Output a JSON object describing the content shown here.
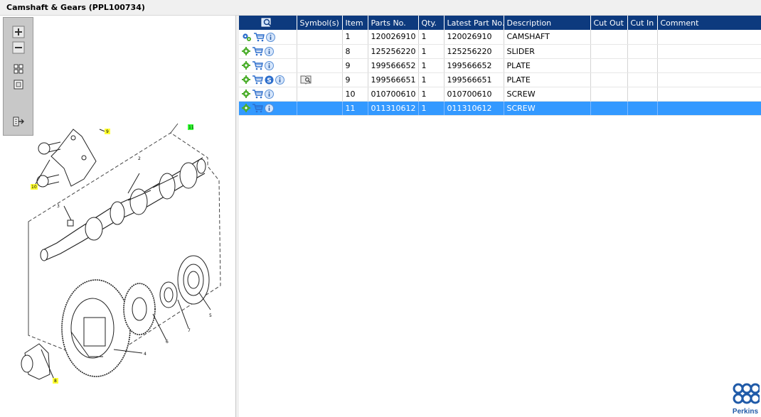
{
  "window": {
    "title": "Camshaft & Gears (PPL100734)"
  },
  "toolbox": {
    "tools": [
      "zoom-in-icon",
      "zoom-out-icon",
      "fit-all-icon",
      "fit-window-icon",
      "export-icon"
    ]
  },
  "diagram": {
    "callouts": {
      "c9": "9",
      "c10": "10",
      "c11": "11",
      "c8": "8",
      "c2": "2",
      "c3": "3",
      "c4": "4",
      "c5": "5",
      "c6": "6",
      "c7": "7"
    }
  },
  "table": {
    "headers": [
      "",
      "Symbol(s)",
      "Item",
      "Parts No.",
      "Qty.",
      "Latest Part No.",
      "Description",
      "Cut Out",
      "Cut In",
      "Comment"
    ],
    "rows": [
      {
        "item": "1",
        "parts_no": "120026910",
        "qty": "1",
        "latest": "120026910",
        "description": "CAMSHAFT",
        "cut_out": "",
        "cut_in": "",
        "comment": ""
      },
      {
        "item": "8",
        "parts_no": "125256220",
        "qty": "1",
        "latest": "125256220",
        "description": "SLIDER",
        "cut_out": "",
        "cut_in": "",
        "comment": ""
      },
      {
        "item": "9",
        "parts_no": "199566652",
        "qty": "1",
        "latest": "199566652",
        "description": "PLATE",
        "cut_out": "",
        "cut_in": "",
        "comment": ""
      },
      {
        "item": "9",
        "parts_no": "199566651",
        "qty": "1",
        "latest": "199566651",
        "description": "PLATE",
        "cut_out": "",
        "cut_in": "",
        "comment": ""
      },
      {
        "item": "10",
        "parts_no": "010700610",
        "qty": "1",
        "latest": "010700610",
        "description": "SCREW",
        "cut_out": "",
        "cut_in": "",
        "comment": ""
      },
      {
        "item": "11",
        "parts_no": "011310612",
        "qty": "1",
        "latest": "011310612",
        "description": "SCREW",
        "cut_out": "",
        "cut_in": "",
        "comment": ""
      }
    ],
    "selected_row": 5
  },
  "logo": {
    "text": "Perkins"
  },
  "colors": {
    "header_bg": "#0d3a7e",
    "selected_bg": "#3399ff",
    "callout_yellow": "#ffff33",
    "callout_green": "#33ff33"
  }
}
